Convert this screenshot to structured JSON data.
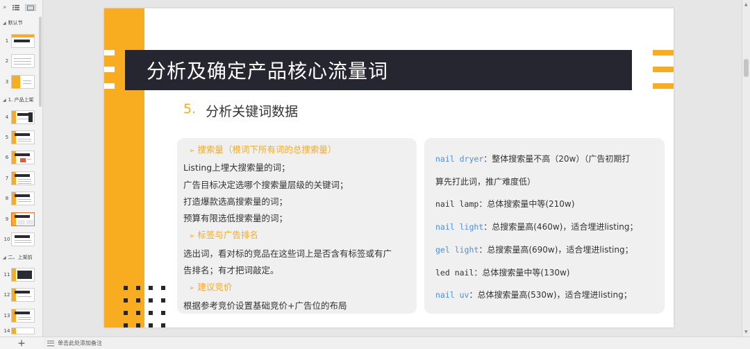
{
  "left_panel": {
    "collapse_glyph": "»",
    "sections": [
      {
        "label": "默认节"
      },
      {
        "label": "1. 产品上架"
      },
      {
        "label": "二、上架前"
      }
    ],
    "slides": [
      "1",
      "2",
      "3",
      "4",
      "5",
      "6",
      "7",
      "8",
      "9",
      "10",
      "11",
      "12",
      "13",
      "14"
    ],
    "active_slide": "9",
    "add_glyph": "+"
  },
  "notes": {
    "placeholder": "单击此处添加备注"
  },
  "slide": {
    "title": "分析及确定产品核心流量词",
    "subtitle_num": "5.",
    "subtitle_text": "分析关键词数据",
    "left_card": {
      "heading1": "搜索量（根词下所有词的总搜索量）",
      "lines1": [
        "Listing上埋大搜索量的词；",
        "广告目标决定选哪个搜索量层级的关键词；",
        "打造爆款选高搜索量的词；",
        "预算有限选低搜索量的词；"
      ],
      "heading2": "标签与广告排名",
      "lines2": [
        "选出词，看对标的竞品在这些词上是否含有标签或有广",
        "告排名；有才把词敲定。"
      ],
      "heading3": "建议竞价",
      "lines3": [
        "根据参考竞价设置基础竞价+广告位的布局"
      ]
    },
    "right_card": {
      "items": [
        {
          "kw": "nail dryer",
          "text": "：整体搜索量不高（20w）（广告初期打"
        },
        {
          "kw": "",
          "text": "算先打此词，推广难度低）"
        },
        {
          "kw": "nail lamp",
          "text": "：总体搜索量中等(210w)"
        },
        {
          "kw": "nail light",
          "text": "：总搜索量高(460w)，适合埋进listing；"
        },
        {
          "kw": "gel light",
          "text": "：总搜索量高(690w)，适合埋进listing；"
        },
        {
          "kw": "led nail",
          "text": "：总体搜索量中等(130w)"
        },
        {
          "kw": "nail uv",
          "text": "：总体搜索量高(530w)，适合埋进listing；"
        }
      ]
    }
  },
  "colors": {
    "accent": "#f7ad1f",
    "title_bar": "#262630",
    "keyword_blue": "#4a90e2"
  }
}
